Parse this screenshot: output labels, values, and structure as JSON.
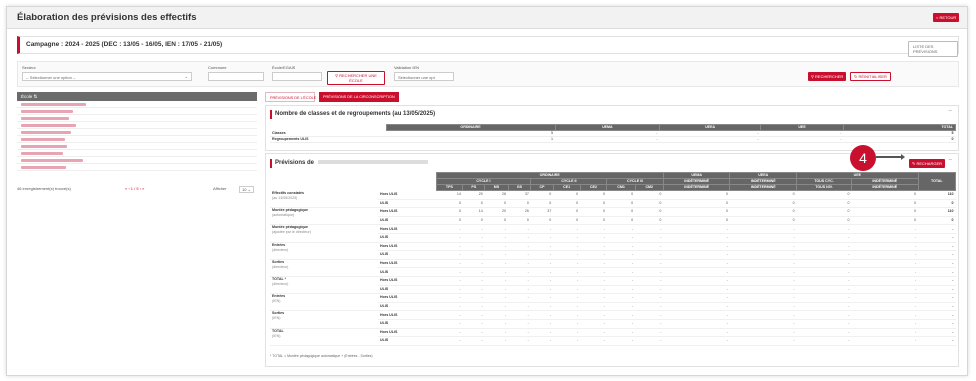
{
  "page": {
    "title": "Élaboration des prévisions des effectifs",
    "retour_label": "< RETOUR",
    "campaign": "Campagne : 2024 - 2025 (DEC : 13/05 - 16/05, IEN : 17/05 - 21/05)",
    "liste_previsions_label": "LISTE DES PRÉVISIONS"
  },
  "filters": {
    "secteur_label": "Secteur",
    "secteur_value": "-- Sélectionner une option --",
    "commune_label": "Commune",
    "ecole_label": "École/EGAIS",
    "rechercher_ecole_label": "RECHERCHER UNE ÉCOLE",
    "validation_label": "Validation IEN",
    "validation_value": "Sélectionner une opt",
    "rechercher_label": "RECHERCHER",
    "reinitialiser_label": "RÉINITIALISER"
  },
  "left_panel": {
    "header": "École",
    "footer_count": "46 enregistrement(s) trouvé(s)",
    "pagination": "1 / 5",
    "afficher_label": "Afficher",
    "afficher_value": "10"
  },
  "tabs": [
    {
      "label": "PRÉVISIONS DE L'ÉCOLE"
    },
    {
      "label": "PRÉVISIONS DE LA CIRCONSCRIPTION"
    }
  ],
  "classes_panel": {
    "title": "Nombre de classes et de regroupements (au 13/05/2025)",
    "columns": [
      "ORDINAIRE",
      "UEMA",
      "UEEA",
      "UEE",
      "TOTAL"
    ],
    "rows": [
      {
        "label": "Classes",
        "values": [
          "5",
          "-",
          "-",
          "-",
          "5"
        ]
      },
      {
        "label": "Regroupements ULIS",
        "values": [
          "1",
          "-",
          "-",
          "-",
          "0"
        ]
      }
    ]
  },
  "previsions_panel": {
    "title": "Prévisions de",
    "recharger_label": "RECHARGER",
    "groups": [
      "ORDINAIRE",
      "UEMA",
      "UEEA",
      "UEE"
    ],
    "cycles": [
      "CYCLE I",
      "CYCLE II",
      "CYCLE III",
      "INDÉTERMINÉ",
      "INDÉTERMINÉ",
      "TOUS CYC.",
      "INDÉTERMINÉ"
    ],
    "levels": [
      "TPS",
      "PS",
      "MS",
      "GS",
      "CP",
      "CE1",
      "CE2",
      "CM1",
      "CM2",
      "INDÉTERMINÉ",
      "INDÉTERMINÉ",
      "TOUS NIV.",
      "INDÉTERMINÉ"
    ],
    "total_label": "TOTAL",
    "rows": [
      {
        "l1": "Effectifs constatés",
        "l2": "(au 13/05/2025)",
        "sub": [
          "Hors ULIS",
          "ULIS"
        ],
        "vals": [
          [
            "14",
            "20",
            "26",
            "37",
            "0",
            "0",
            "0",
            "0",
            "0",
            "0",
            "0",
            "0",
            "0",
            "110"
          ],
          [
            "0",
            "0",
            "0",
            "0",
            "0",
            "0",
            "0",
            "0",
            "0",
            "0",
            "0",
            "0",
            "0",
            "0"
          ]
        ],
        "total": "110"
      },
      {
        "l1": "Montée pédagogique",
        "l2": "(automatique)",
        "sub": [
          "Hors ULIS",
          "ULIS"
        ],
        "vals": [
          [
            "0",
            "14",
            "20",
            "26",
            "37",
            "0",
            "0",
            "0",
            "0",
            "0",
            "0",
            "0",
            "0",
            "110"
          ],
          [
            "0",
            "0",
            "0",
            "0",
            "0",
            "0",
            "0",
            "0",
            "0",
            "0",
            "0",
            "0",
            "0",
            "0"
          ]
        ],
        "total": "110"
      },
      {
        "l1": "Montée pédagogique",
        "l2": "(ajustée par le directeur)",
        "sub": [
          "Hors ULIS",
          "ULIS"
        ],
        "vals": [
          [
            "-",
            "-",
            "-",
            "-",
            "-",
            "-",
            "-",
            "-",
            "-",
            "-",
            "-",
            "-",
            "-",
            "-"
          ],
          [
            "-",
            "-",
            "-",
            "-",
            "-",
            "-",
            "-",
            "-",
            "-",
            "-",
            "-",
            "-",
            "-",
            "-"
          ]
        ],
        "total": "-"
      },
      {
        "l1": "Entrées",
        "l2": "(directeur)",
        "sub": [
          "Hors ULIS",
          "ULIS"
        ],
        "vals": [
          [
            "-",
            "-",
            "-",
            "-",
            "-",
            "-",
            "-",
            "-",
            "-",
            "-",
            "-",
            "-",
            "-",
            "-"
          ],
          [
            "-",
            "-",
            "-",
            "-",
            "-",
            "-",
            "-",
            "-",
            "-",
            "-",
            "-",
            "-",
            "-",
            "-"
          ]
        ],
        "total": "-"
      },
      {
        "l1": "Sorties",
        "l2": "(directeur)",
        "sub": [
          "Hors ULIS",
          "ULIS"
        ],
        "vals": [
          [
            "-",
            "-",
            "-",
            "-",
            "-",
            "-",
            "-",
            "-",
            "-",
            "-",
            "-",
            "-",
            "-",
            "-"
          ],
          [
            "-",
            "-",
            "-",
            "-",
            "-",
            "-",
            "-",
            "-",
            "-",
            "-",
            "-",
            "-",
            "-",
            "-"
          ]
        ],
        "total": "-"
      },
      {
        "l1": "TOTAL *",
        "l2": "(directeur)",
        "sub": [
          "Hors ULIS",
          "ULIS"
        ],
        "vals": [
          [
            "-",
            "-",
            "-",
            "-",
            "-",
            "-",
            "-",
            "-",
            "-",
            "-",
            "-",
            "-",
            "-",
            "-"
          ],
          [
            "-",
            "-",
            "-",
            "-",
            "-",
            "-",
            "-",
            "-",
            "-",
            "-",
            "-",
            "-",
            "-",
            "-"
          ]
        ],
        "total": "-"
      },
      {
        "l1": "Entrées",
        "l2": "(IEN)",
        "sub": [
          "Hors ULIS",
          "ULIS"
        ],
        "vals": [
          [
            "-",
            "-",
            "-",
            "-",
            "-",
            "-",
            "-",
            "-",
            "-",
            "-",
            "-",
            "-",
            "-",
            "-"
          ],
          [
            "-",
            "-",
            "-",
            "-",
            "-",
            "-",
            "-",
            "-",
            "-",
            "-",
            "-",
            "-",
            "-",
            "-"
          ]
        ],
        "total": "-"
      },
      {
        "l1": "Sorties",
        "l2": "(IEN)",
        "sub": [
          "Hors ULIS",
          "ULIS"
        ],
        "vals": [
          [
            "-",
            "-",
            "-",
            "-",
            "-",
            "-",
            "-",
            "-",
            "-",
            "-",
            "-",
            "-",
            "-",
            "-"
          ],
          [
            "-",
            "-",
            "-",
            "-",
            "-",
            "-",
            "-",
            "-",
            "-",
            "-",
            "-",
            "-",
            "-",
            "-"
          ]
        ],
        "total": "-"
      },
      {
        "l1": "TOTAL",
        "l2": "(IEN)",
        "sub": [
          "Hors ULIS",
          "ULIS"
        ],
        "vals": [
          [
            "-",
            "-",
            "-",
            "-",
            "-",
            "-",
            "-",
            "-",
            "-",
            "-",
            "-",
            "-",
            "-",
            "-"
          ],
          [
            "-",
            "-",
            "-",
            "-",
            "-",
            "-",
            "-",
            "-",
            "-",
            "-",
            "-",
            "-",
            "-",
            "-"
          ]
        ],
        "total": "-"
      }
    ],
    "footnote": "* TOTAL = Montée pédagogique automatique + (Entrées - Sorties)"
  },
  "callout": {
    "number": "4"
  },
  "colors": {
    "accent": "#c8102e",
    "header_grey": "#666666"
  }
}
